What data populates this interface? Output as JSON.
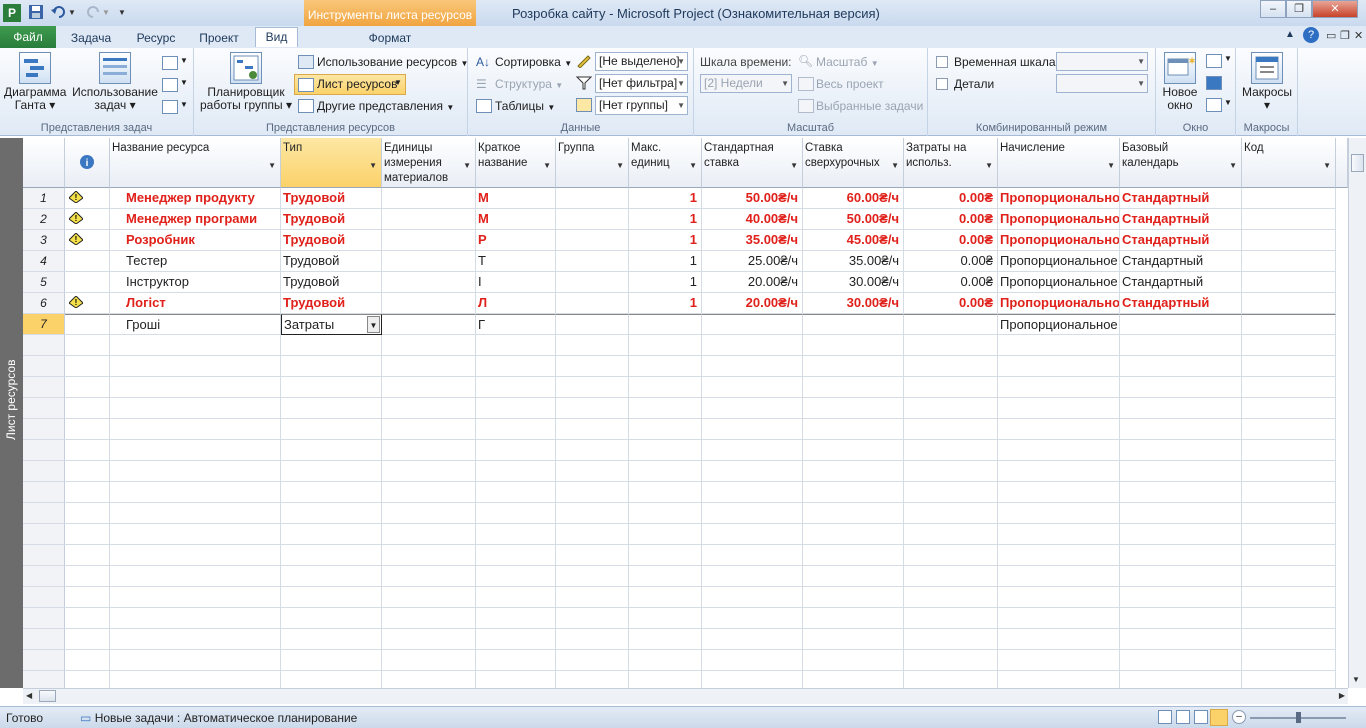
{
  "window": {
    "title": "Розробка сайту  -  Microsoft Project (Ознакомительная версия)",
    "context_tab_header": "Инструменты листа ресурсов",
    "minimize": "–",
    "restore": "❐",
    "close": "✕"
  },
  "tabs": [
    "Файл",
    "Задача",
    "Ресурс",
    "Проект",
    "Вид",
    "Формат"
  ],
  "ribbon": {
    "task_views": {
      "gantt": "Диаграмма Ганта",
      "task_usage": "Использование задач",
      "label": "Представления задач"
    },
    "resource_views": {
      "team_planner": "Планировщик работы группы",
      "resource_usage": "Использование ресурсов",
      "resource_sheet": "Лист ресурсов",
      "other_views": "Другие представления",
      "label": "Представления ресурсов"
    },
    "data": {
      "sort": "Сортировка",
      "outline": "Структура",
      "tables": "Таблицы",
      "highlight": "[Не выделено]",
      "filter": "[Нет фильтра]",
      "group": "[Нет группы]",
      "label": "Данные"
    },
    "zoom": {
      "timescale": "Шкала времени:",
      "timescale_value": "[2] Недели",
      "zoom": "Масштаб",
      "entire_project": "Весь проект",
      "selected_tasks": "Выбранные задачи",
      "label": "Масштаб"
    },
    "split_view": {
      "timeline": "Временная шкала",
      "details": "Детали",
      "label": "Комбинированный режим"
    },
    "window": {
      "new_window": "Новое окно",
      "label": "Окно"
    },
    "macros": {
      "macros": "Макросы",
      "label": "Макросы"
    }
  },
  "sidebar_label": "Лист ресурсов",
  "columns": [
    "Название ресурса",
    "Тип",
    "Единицы измерения материалов",
    "Краткое название",
    "Группа",
    "Макс. единиц",
    "Стандартная ставка",
    "Ставка сверхурочных",
    "Затраты на использ.",
    "Начисление",
    "Базовый календарь",
    "Код"
  ],
  "rows": [
    {
      "id": "1",
      "warn": true,
      "red": true,
      "name": "Менеджер продукту",
      "type": "Трудовой",
      "initials": "М",
      "max": "1",
      "std": "50.00₴/ч",
      "ovt": "60.00₴/ч",
      "cost": "0.00₴",
      "accrue": "Пропорциональное",
      "cal": "Стандартный"
    },
    {
      "id": "2",
      "warn": true,
      "red": true,
      "name": "Менеджер програми",
      "type": "Трудовой",
      "initials": "М",
      "max": "1",
      "std": "40.00₴/ч",
      "ovt": "50.00₴/ч",
      "cost": "0.00₴",
      "accrue": "Пропорциональное",
      "cal": "Стандартный"
    },
    {
      "id": "3",
      "warn": true,
      "red": true,
      "name": "Розробник",
      "type": "Трудовой",
      "initials": "Р",
      "max": "1",
      "std": "35.00₴/ч",
      "ovt": "45.00₴/ч",
      "cost": "0.00₴",
      "accrue": "Пропорциональное",
      "cal": "Стандартный"
    },
    {
      "id": "4",
      "warn": false,
      "red": false,
      "name": "Тестер",
      "type": "Трудовой",
      "initials": "Т",
      "max": "1",
      "std": "25.00₴/ч",
      "ovt": "35.00₴/ч",
      "cost": "0.00₴",
      "accrue": "Пропорциональное",
      "cal": "Стандартный"
    },
    {
      "id": "5",
      "warn": false,
      "red": false,
      "name": "Інструктор",
      "type": "Трудовой",
      "initials": "І",
      "max": "1",
      "std": "20.00₴/ч",
      "ovt": "30.00₴/ч",
      "cost": "0.00₴",
      "accrue": "Пропорциональное",
      "cal": "Стандартный"
    },
    {
      "id": "6",
      "warn": true,
      "red": true,
      "name": "Логіст",
      "type": "Трудовой",
      "initials": "Л",
      "max": "1",
      "std": "20.00₴/ч",
      "ovt": "30.00₴/ч",
      "cost": "0.00₴",
      "accrue": "Пропорциональное",
      "cal": "Стандартный"
    },
    {
      "id": "7",
      "warn": false,
      "red": false,
      "name": "Гроші",
      "type": "Затраты",
      "initials": "Г",
      "max": "",
      "std": "",
      "ovt": "",
      "cost": "",
      "accrue": "Пропорциональное",
      "cal": ""
    }
  ],
  "status": {
    "ready": "Готово",
    "new_tasks": "Новые задачи : Автоматическое планирование"
  },
  "colors": {
    "overalloc": "#e0201a",
    "accent": "#f0a23c",
    "file_tab": "#2a7d3b"
  }
}
